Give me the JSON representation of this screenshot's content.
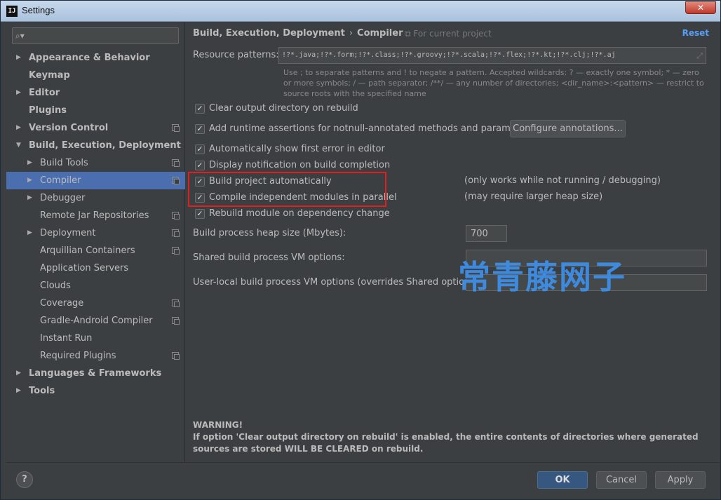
{
  "window": {
    "title": "Settings",
    "app_icon": "IJ",
    "close_glyph": "✕"
  },
  "sidebar": {
    "search_placeholder": "",
    "items": [
      {
        "label": "Appearance & Behavior",
        "level": 0,
        "arrow": "▶",
        "bold": true
      },
      {
        "label": "Keymap",
        "level": 0,
        "arrow": "",
        "bold": true
      },
      {
        "label": "Editor",
        "level": 0,
        "arrow": "▶",
        "bold": true
      },
      {
        "label": "Plugins",
        "level": 0,
        "arrow": "",
        "bold": true
      },
      {
        "label": "Version Control",
        "level": 0,
        "arrow": "▶",
        "bold": true,
        "project": true
      },
      {
        "label": "Build, Execution, Deployment",
        "level": 0,
        "arrow": "▼",
        "bold": true
      },
      {
        "label": "Build Tools",
        "level": 1,
        "arrow": "▶",
        "project": true
      },
      {
        "label": "Compiler",
        "level": 1,
        "arrow": "▶",
        "project": true,
        "selected": true
      },
      {
        "label": "Debugger",
        "level": 1,
        "arrow": "▶"
      },
      {
        "label": "Remote Jar Repositories",
        "level": 1,
        "arrow": "",
        "project": true
      },
      {
        "label": "Deployment",
        "level": 1,
        "arrow": "▶",
        "project": true
      },
      {
        "label": "Arquillian Containers",
        "level": 1,
        "arrow": "",
        "project": true
      },
      {
        "label": "Application Servers",
        "level": 1,
        "arrow": ""
      },
      {
        "label": "Clouds",
        "level": 1,
        "arrow": ""
      },
      {
        "label": "Coverage",
        "level": 1,
        "arrow": "",
        "project": true
      },
      {
        "label": "Gradle-Android Compiler",
        "level": 1,
        "arrow": "",
        "project": true
      },
      {
        "label": "Instant Run",
        "level": 1,
        "arrow": ""
      },
      {
        "label": "Required Plugins",
        "level": 1,
        "arrow": "",
        "project": true
      },
      {
        "label": "Languages & Frameworks",
        "level": 0,
        "arrow": "▶",
        "bold": true
      },
      {
        "label": "Tools",
        "level": 0,
        "arrow": "▶",
        "bold": true
      }
    ]
  },
  "header": {
    "crumb_parent": "Build, Execution, Deployment",
    "crumb_sep": "›",
    "crumb_current": "Compiler",
    "for_project": "For current project",
    "reset": "Reset"
  },
  "resource": {
    "label": "Resource patterns:",
    "value": "!?*.java;!?*.form;!?*.class;!?*.groovy;!?*.scala;!?*.flex;!?*.kt;!?*.clj;!?*.aj",
    "hint": "Use ; to separate patterns and ! to negate a pattern. Accepted wildcards: ? — exactly one symbol; * — zero or more symbols; / — path separator; /**/ — any number of directories; <dir_name>:<pattern> — restrict to source roots with the specified name"
  },
  "options": [
    {
      "label": "Clear output directory on rebuild",
      "checked": true
    },
    {
      "label": "Add runtime assertions for notnull-annotated methods and parameters",
      "checked": true
    },
    {
      "label": "Automatically show first error in editor",
      "checked": true
    },
    {
      "label": "Display notification on build completion",
      "checked": true
    },
    {
      "label": "Build project automatically",
      "checked": true,
      "note": "(only works while not running / debugging)"
    },
    {
      "label": "Compile independent modules in parallel",
      "checked": true,
      "note": "(may require larger heap size)"
    },
    {
      "label": "Rebuild module on dependency change",
      "checked": true
    }
  ],
  "configure_button": "Configure annotations...",
  "heap": {
    "label": "Build process heap size (Mbytes):",
    "value": "700"
  },
  "shared_vm": {
    "label": "Shared build process VM options:",
    "value": ""
  },
  "local_vm": {
    "label": "User-local build process VM options (overrides Shared options):",
    "value": ""
  },
  "watermark": "常青藤网子",
  "warning": {
    "title": "WARNING!",
    "text": "If option 'Clear output directory on rebuild' is enabled, the entire contents of directories where generated sources are stored WILL BE CLEARED on rebuild."
  },
  "footer": {
    "help": "?",
    "ok": "OK",
    "cancel": "Cancel",
    "apply": "Apply"
  },
  "colors": {
    "background": "#3c3f41",
    "selection": "#4b6eaf",
    "link": "#589df6",
    "highlight_border": "#e02020",
    "watermark": "#3d8ee6"
  }
}
